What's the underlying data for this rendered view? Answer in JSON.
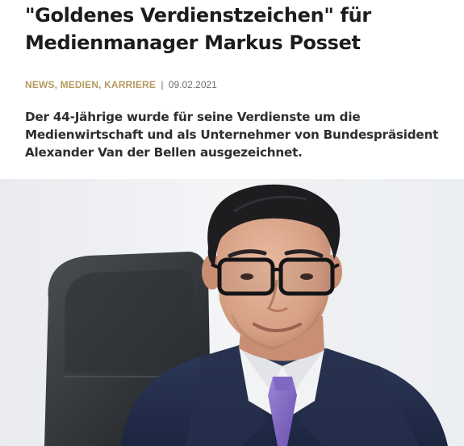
{
  "article": {
    "headline_line1": "\"Goldenes Verdienstzeichen\" für",
    "headline_line2": "Medienmanager Markus Posset",
    "categories": "NEWS, MEDIEN, KARRIERE",
    "separator": "|",
    "date": "09.02.2021",
    "lead_line1": "Der 44-Jährige wurde für seine Verdienste um die",
    "lead_line2": "Medienwirtschaft und als Unternehmer von Bundespräsident",
    "lead_line3": "Alexander Van der Bellen ausgezeichnet."
  },
  "colors": {
    "headline": "#1c1c1c",
    "category_accent": "#b39a5e",
    "lead_text": "#2e2e2e",
    "background": "#ffffff"
  }
}
